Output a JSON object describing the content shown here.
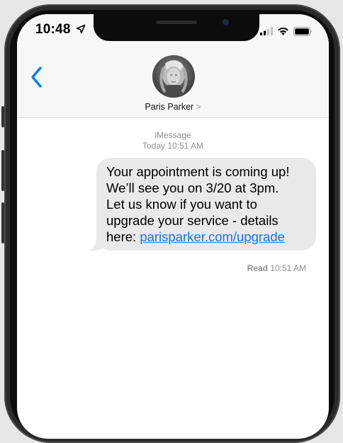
{
  "status_bar": {
    "time": "10:48",
    "icons": [
      "location-arrow-icon",
      "cellular-signal-icon",
      "wifi-icon",
      "battery-icon"
    ]
  },
  "header": {
    "back_icon": "chevron-left-icon",
    "contact_name": "Paris Parker",
    "contact_chevron": ">"
  },
  "conversation": {
    "service": "iMessage",
    "timestamp": "Today 10:51 AM",
    "message": {
      "line1": "Your appointment is coming up!",
      "line2": "We’ll see you on 3/20 at 3pm.",
      "line3": "Let us know if you want to",
      "line4": "upgrade your service - details",
      "line5_prefix": "here: ",
      "link_text": "parisparker.com/upgrade"
    },
    "read_status_label": "Read",
    "read_time": "10:51 AM"
  },
  "colors": {
    "bubble_incoming": "#e9e9eb",
    "link": "#1a73e8",
    "ios_blue": "#0a7aff",
    "meta_gray": "#8e8e93"
  }
}
